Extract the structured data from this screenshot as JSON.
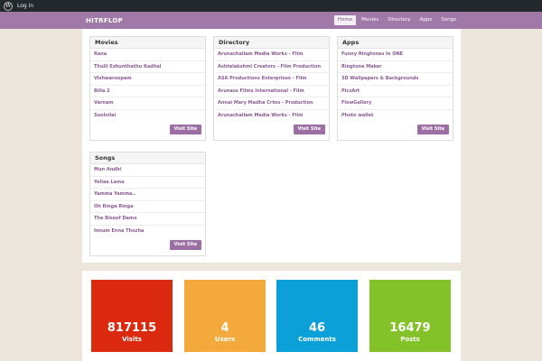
{
  "adminbar": {
    "logo_icon": "wordpress-icon",
    "login_label": "Log in"
  },
  "header": {
    "site_title": "HITRFLOP",
    "nav": [
      "Home",
      "Movies",
      "Directory",
      "Apps",
      "Songs"
    ],
    "accent": "#a079a8"
  },
  "widgets": {
    "movies": {
      "title": "Movies",
      "items": [
        "Rana",
        "Thulli Ezhunthathu Kadhal",
        "Vishwaroopam",
        "Billa 2",
        "Varnam",
        "Soolnilai"
      ],
      "button": "Visit Site"
    },
    "directory": {
      "title": "Directory",
      "items": [
        "Arunachallam Media Works - Film",
        "Ashtalakshmi Creators - Film Production",
        "ASA Productions Enterprises - Film",
        "Arunass Films International - Film",
        "Annai Mary Madha Crtns - Production",
        "Arunachallam Media Works - Film"
      ],
      "button": "Visit Site"
    },
    "apps": {
      "title": "Apps",
      "items": [
        "Funny Ringtones In ONE",
        "Ringtone Maker",
        "3D Wallpapers & Backgrounds",
        "PicsArt",
        "FlowGallery",
        "Photo wallet"
      ],
      "button": "Visit Site"
    },
    "songs": {
      "title": "Songs",
      "items": [
        "Mun Andhi",
        "Yellae Lama",
        "Yamma Yamma..",
        "Oh Ringa Ringa",
        "The Riseof Damo",
        "Innum Enna Thozha"
      ],
      "button": "Visit Site"
    }
  },
  "stats": [
    {
      "value": "817115",
      "label": "Visits",
      "color": "#dc2a10"
    },
    {
      "value": "4",
      "label": "Users",
      "color": "#f3a93c"
    },
    {
      "value": "46",
      "label": "Comments",
      "color": "#0ca0d8"
    },
    {
      "value": "16479",
      "label": "Posts",
      "color": "#84c22a"
    }
  ]
}
